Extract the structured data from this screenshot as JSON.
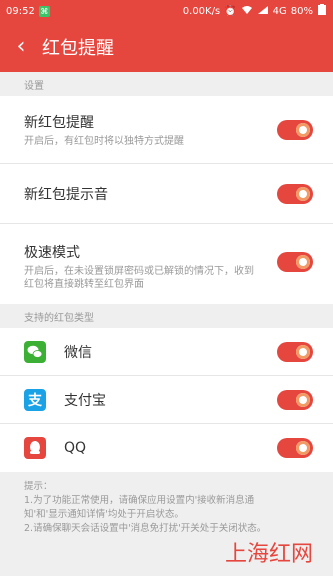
{
  "status_bar": {
    "time": "09:52",
    "network_speed": "0.00K/s",
    "network_type": "4G",
    "battery": "80%"
  },
  "header": {
    "back_icon": "‹",
    "title": "红包提醒"
  },
  "settings_section": {
    "title": "设置",
    "items": [
      {
        "label": "新红包提醒",
        "description": "开启后，有红包时将以独特方式提醒",
        "enabled": true
      },
      {
        "label": "新红包提示音",
        "description": "",
        "enabled": true
      },
      {
        "label": "极速模式",
        "description": "开启后，在未设置锁屏密码或已解锁的情况下，收到红包将直接跳转至红包界面",
        "enabled": true
      }
    ]
  },
  "supported_section": {
    "title": "支持的红包类型",
    "items": [
      {
        "label": "微信",
        "icon": "wechat-icon",
        "color": "#3cb034",
        "enabled": true
      },
      {
        "label": "支付宝",
        "icon": "alipay-icon",
        "color": "#1aa2e6",
        "enabled": true
      },
      {
        "label": "QQ",
        "icon": "qq-icon",
        "color": "#e5473f",
        "enabled": true
      }
    ]
  },
  "tips": {
    "heading": "提示：",
    "line1": "1.为了功能正常使用，请确保应用设置内'接收新消息通",
    "line2": "知'和'显示通知详情'均处于开启状态。",
    "line3": "2.请确保聊天会话设置中'消息免打扰'开关处于关闭状态。"
  },
  "watermark": "上海红网",
  "colors": {
    "accent": "#e5473f",
    "toggle_knob_ring": "#f29a66"
  }
}
